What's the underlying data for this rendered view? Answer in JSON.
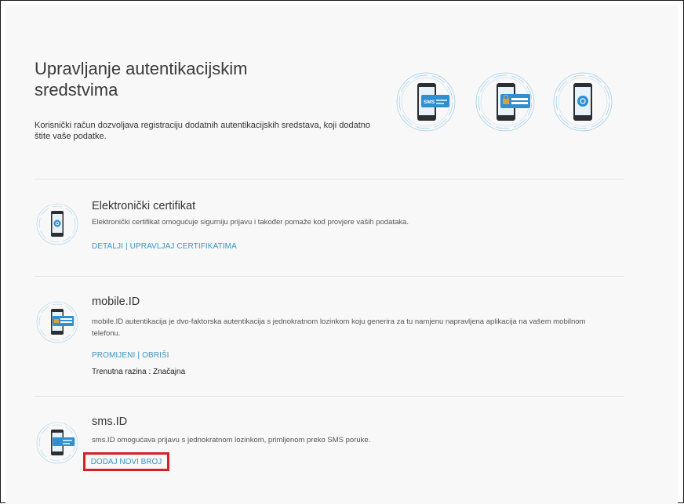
{
  "page": {
    "title": "Upravljanje autentikacijskim sredstvima",
    "intro": "Korisnički račun dozvoljava registraciju dodatnih autentikacijskih sredstava, koji dodatno štite vaše podatke."
  },
  "hero": {
    "sms_badge_text": "SMS",
    "icons": [
      "sms-phone-icon",
      "password-phone-icon",
      "certificate-phone-icon"
    ]
  },
  "sections": {
    "certificate": {
      "title": "Elektronički certifikat",
      "description": "Elektronički certifikat omogućuje sigurniju prijavu i također pomaže kod provjere vaših podataka.",
      "link_details": "DETALJI",
      "separator": "|",
      "link_manage": "UPRAVLJAJ CERTIFIKATIMA"
    },
    "mobile_id": {
      "title": "mobile.ID",
      "description": "mobile.ID autentikacija je dvo-faktorska autentikacija s jednokratnom lozinkom koju generira za tu namjenu napravljena aplikacija na vašem mobilnom telefonu.",
      "link_change": "PROMIJENI",
      "separator": "|",
      "link_delete": "OBRIŠI",
      "level": "Trenutna razina : Značajna"
    },
    "sms_id": {
      "title": "sms.ID",
      "description": "sms.ID omogućava prijavu s jednokratnom lozinkom, primljenom preko SMS poruke.",
      "link_add": "DODAJ NOVI BROJ"
    }
  },
  "colors": {
    "accent_blue": "#3a93c4",
    "highlight_red": "#d62027",
    "phone_dark": "#2b2f33",
    "phone_screen_blue": "#2f8fd0"
  }
}
